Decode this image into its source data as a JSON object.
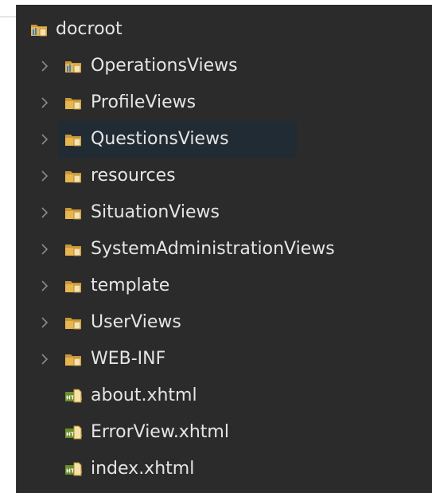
{
  "tree": {
    "root": {
      "label": "docroot",
      "icon": "folder-web-icon"
    },
    "items": [
      {
        "label": "OperationsViews",
        "type": "folder",
        "icon": "folder-web-icon",
        "expandable": true
      },
      {
        "label": "ProfileViews",
        "type": "folder",
        "icon": "folder-icon",
        "expandable": true
      },
      {
        "label": "QuestionsViews",
        "type": "folder",
        "icon": "folder-icon",
        "expandable": true,
        "selected": true
      },
      {
        "label": "resources",
        "type": "folder",
        "icon": "folder-icon",
        "expandable": true
      },
      {
        "label": "SituationViews",
        "type": "folder",
        "icon": "folder-icon",
        "expandable": true
      },
      {
        "label": "SystemAdministrationViews",
        "type": "folder",
        "icon": "folder-icon",
        "expandable": true
      },
      {
        "label": "template",
        "type": "folder",
        "icon": "folder-icon",
        "expandable": true
      },
      {
        "label": "UserViews",
        "type": "folder",
        "icon": "folder-icon",
        "expandable": true
      },
      {
        "label": "WEB-INF",
        "type": "folder",
        "icon": "folder-icon",
        "expandable": true
      },
      {
        "label": "about.xhtml",
        "type": "file",
        "icon": "html-file-icon",
        "expandable": false
      },
      {
        "label": "ErrorView.xhtml",
        "type": "file",
        "icon": "html-file-icon",
        "expandable": false
      },
      {
        "label": "index.xhtml",
        "type": "file",
        "icon": "html-file-icon",
        "expandable": false
      }
    ]
  },
  "colors": {
    "background": "#2b2b2b",
    "text": "#e5e5e5",
    "selection": "#212b34",
    "chevron": "#8a8a8a",
    "folder": "#e8b64f"
  }
}
